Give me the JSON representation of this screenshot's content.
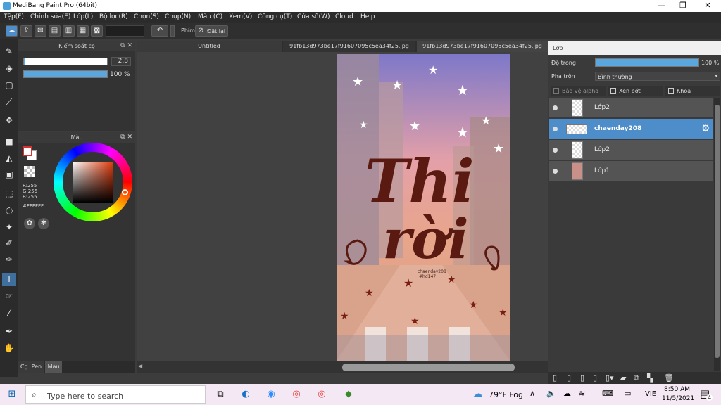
{
  "window": {
    "title": "MediBang Paint Pro (64bit)",
    "minimize": "—",
    "maximize": "❐",
    "close": "✕"
  },
  "menu": {
    "items": [
      "Tệp(F)",
      "Chỉnh sửa(E)",
      "Lớp(L)",
      "Bộ lọc(R)",
      "Chọn(S)",
      "Chụp(N)",
      "Màu (C)",
      "Xem(V)",
      "Công cụ(T)",
      "Cửa sổ(W)",
      "Cloud",
      "Help"
    ]
  },
  "toolbar": {
    "undo_icon": "undo-icon",
    "key_label": "Phím",
    "reset_label": "Đặt lại"
  },
  "brush_panel": {
    "title": "Kiểm soát cọ",
    "size_value": "2.8",
    "opacity_value": "100 %",
    "size_fraction": 0.02,
    "opacity_fraction": 1.0
  },
  "color_panel": {
    "title": "Màu",
    "r": "R:255",
    "g": "G:255",
    "b": "B:255",
    "hex": "#FFFFFF",
    "fg_color": "#d93030",
    "bg_color": "#ffffff"
  },
  "bottom_tabs": {
    "pen": "Cọ: Pen",
    "color": "Màu"
  },
  "canvas_tabs": [
    {
      "label": "Untitled"
    },
    {
      "label": "91fb13d973be17f91607095c5ea34f25.jpg"
    },
    {
      "label": "91fb13d973be17f91607095c5ea34f25.jpg"
    }
  ],
  "artwork": {
    "line1": "Thi",
    "line2": "rời",
    "signature": "chaenday208",
    "tag": "#hd147"
  },
  "layers_panel": {
    "title": "Lớp",
    "opacity_label": "Độ trong",
    "opacity_value": "100 %",
    "opacity_fraction": 1.0,
    "blend_label": "Pha trộn",
    "blend_value": "Bình thường",
    "protect_alpha": "Bảo vệ alpha",
    "clipping": "Xén bớt",
    "lock": "Khóa",
    "layers": [
      {
        "name": "Lớp2",
        "selected": false
      },
      {
        "name": "chaenday208",
        "selected": true
      },
      {
        "name": "Lớp2",
        "selected": false
      },
      {
        "name": "Lớp1",
        "selected": false
      }
    ]
  },
  "taskbar": {
    "search_placeholder": "Type here to search",
    "weather": "79°F  Fog",
    "lang": "VIE",
    "time": "8:50 AM",
    "date": "11/5/2021",
    "notif_count": "4"
  }
}
